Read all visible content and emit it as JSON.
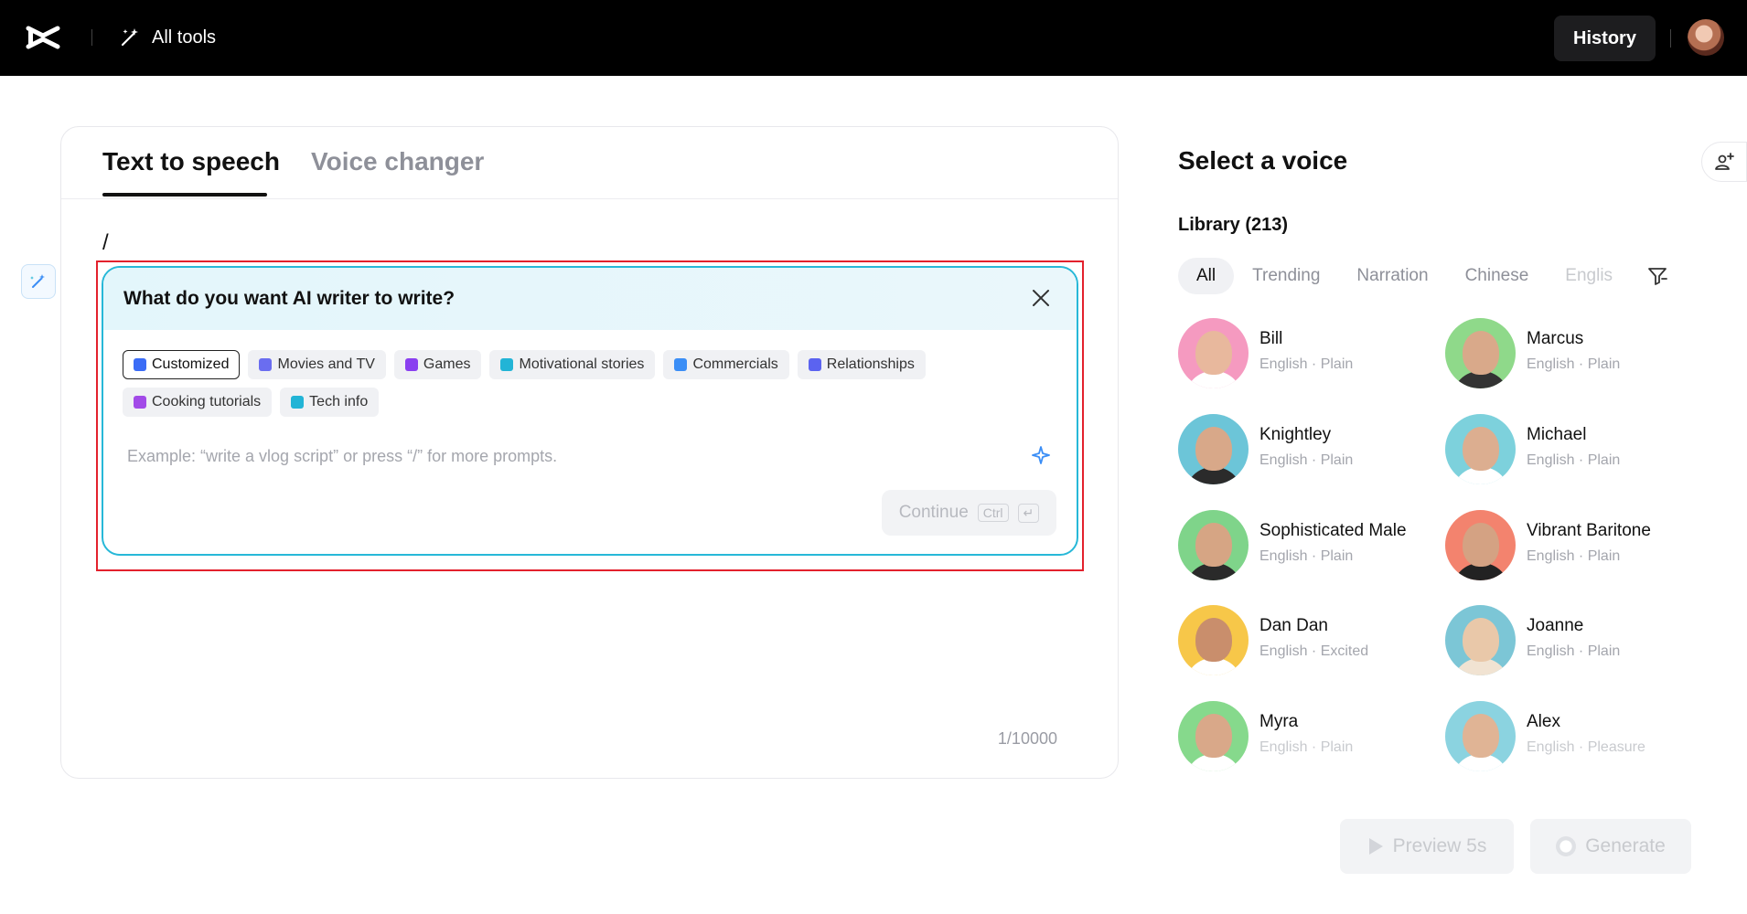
{
  "topbar": {
    "all_tools_label": "All tools",
    "history_label": "History"
  },
  "tabs": [
    {
      "label": "Text to speech"
    },
    {
      "label": "Voice changer"
    }
  ],
  "editor": {
    "text": "/",
    "counter": "1/10000"
  },
  "ai_writer": {
    "title": "What do you want AI writer to write?",
    "chips": [
      {
        "label": "Customized",
        "color": "#3b6cf6"
      },
      {
        "label": "Movies and TV",
        "color": "#6a6df0"
      },
      {
        "label": "Games",
        "color": "#8a3ff0"
      },
      {
        "label": "Motivational stories",
        "color": "#22b4d6"
      },
      {
        "label": "Commercials",
        "color": "#3b8ef6"
      },
      {
        "label": "Relationships",
        "color": "#5b63f0"
      },
      {
        "label": "Cooking tutorials",
        "color": "#a24ae8"
      },
      {
        "label": "Tech info",
        "color": "#22b4d6"
      }
    ],
    "placeholder": "Example: “write a vlog script” or press “/” for more prompts.",
    "continue_label": "Continue",
    "continue_kbd": "Ctrl"
  },
  "voices_panel": {
    "title": "Select a voice",
    "library_label": "Library (213)",
    "filters": [
      "All",
      "Trending",
      "Narration",
      "Chinese",
      "Englis"
    ],
    "voices": [
      {
        "name": "Bill",
        "meta": "English · Plain",
        "bg": "#f59ac0"
      },
      {
        "name": "Marcus",
        "meta": "English · Plain",
        "bg": "#8fd98a"
      },
      {
        "name": "Knightley",
        "meta": "English · Plain",
        "bg": "#6cc5d8"
      },
      {
        "name": "Michael",
        "meta": "English · Plain",
        "bg": "#7dd1dc"
      },
      {
        "name": "Sophisticated Male",
        "meta": "English · Plain",
        "bg": "#7fd48a"
      },
      {
        "name": "Vibrant Baritone",
        "meta": "English · Plain",
        "bg": "#f3836e"
      },
      {
        "name": "Dan Dan",
        "meta": "English · Excited",
        "bg": "#f7c749"
      },
      {
        "name": "Joanne",
        "meta": "English · Plain",
        "bg": "#7cc6d6"
      },
      {
        "name": "Myra",
        "meta": "English · Plain",
        "bg": "#86d98c"
      },
      {
        "name": "Alex",
        "meta": "English · Pleasure",
        "bg": "#8bd3e0"
      }
    ]
  },
  "actions": {
    "preview_label": "Preview 5s",
    "generate_label": "Generate"
  }
}
